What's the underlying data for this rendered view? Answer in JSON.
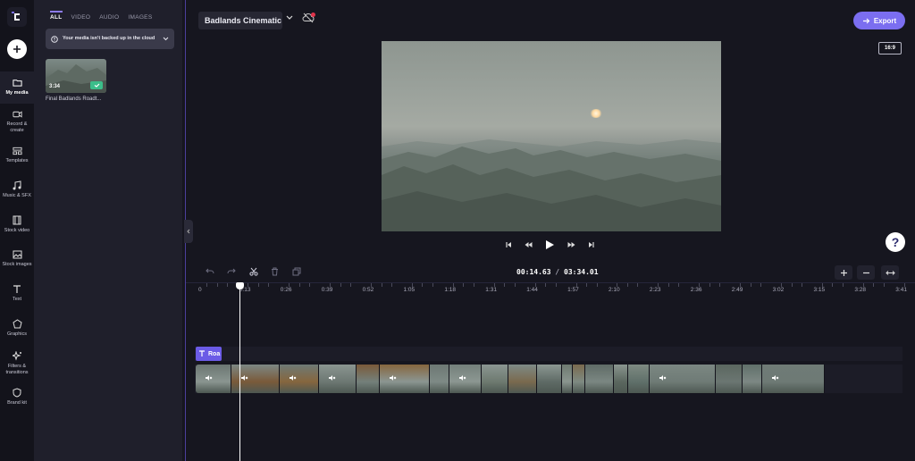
{
  "nav": {
    "items": [
      {
        "label": "My media",
        "icon": "folder-icon"
      },
      {
        "label": "Record & create",
        "icon": "camera-icon"
      },
      {
        "label": "Templates",
        "icon": "templates-icon"
      },
      {
        "label": "Music & SFX",
        "icon": "music-icon"
      },
      {
        "label": "Stock video",
        "icon": "film-icon"
      },
      {
        "label": "Stock images",
        "icon": "image-icon"
      },
      {
        "label": "Text",
        "icon": "text-icon"
      },
      {
        "label": "Graphics",
        "icon": "shapes-icon"
      },
      {
        "label": "Filters & transitions",
        "icon": "sparkle-icon"
      },
      {
        "label": "Brand kit",
        "icon": "shield-icon"
      }
    ]
  },
  "media": {
    "tabs": [
      "ALL",
      "VIDEO",
      "AUDIO",
      "IMAGES"
    ],
    "active_tab": "ALL",
    "notice": "Your media isn't backed up in the cloud",
    "items": [
      {
        "duration": "3:34",
        "name": "Final Badlands Roadt..."
      }
    ]
  },
  "project": {
    "title": "Badlands Cinematic",
    "export_label": "Export",
    "aspect_ratio": "16:9"
  },
  "timeline": {
    "time_current": "00:14.63",
    "time_separator": "/",
    "time_total": "03:34.01",
    "ruler": [
      "0",
      "0:13",
      "0:26",
      "0:39",
      "0:52",
      "1:05",
      "1:18",
      "1:31",
      "1:44",
      "1:57",
      "2:10",
      "2:23",
      "2:36",
      "2:49",
      "3:02",
      "3:15",
      "3:28",
      "3:41"
    ],
    "text_clip_label": "Roa"
  },
  "colors": {
    "accent": "#7b6ef0",
    "text_clip": "#6b5be6",
    "notification_dot": "#e0334a"
  }
}
